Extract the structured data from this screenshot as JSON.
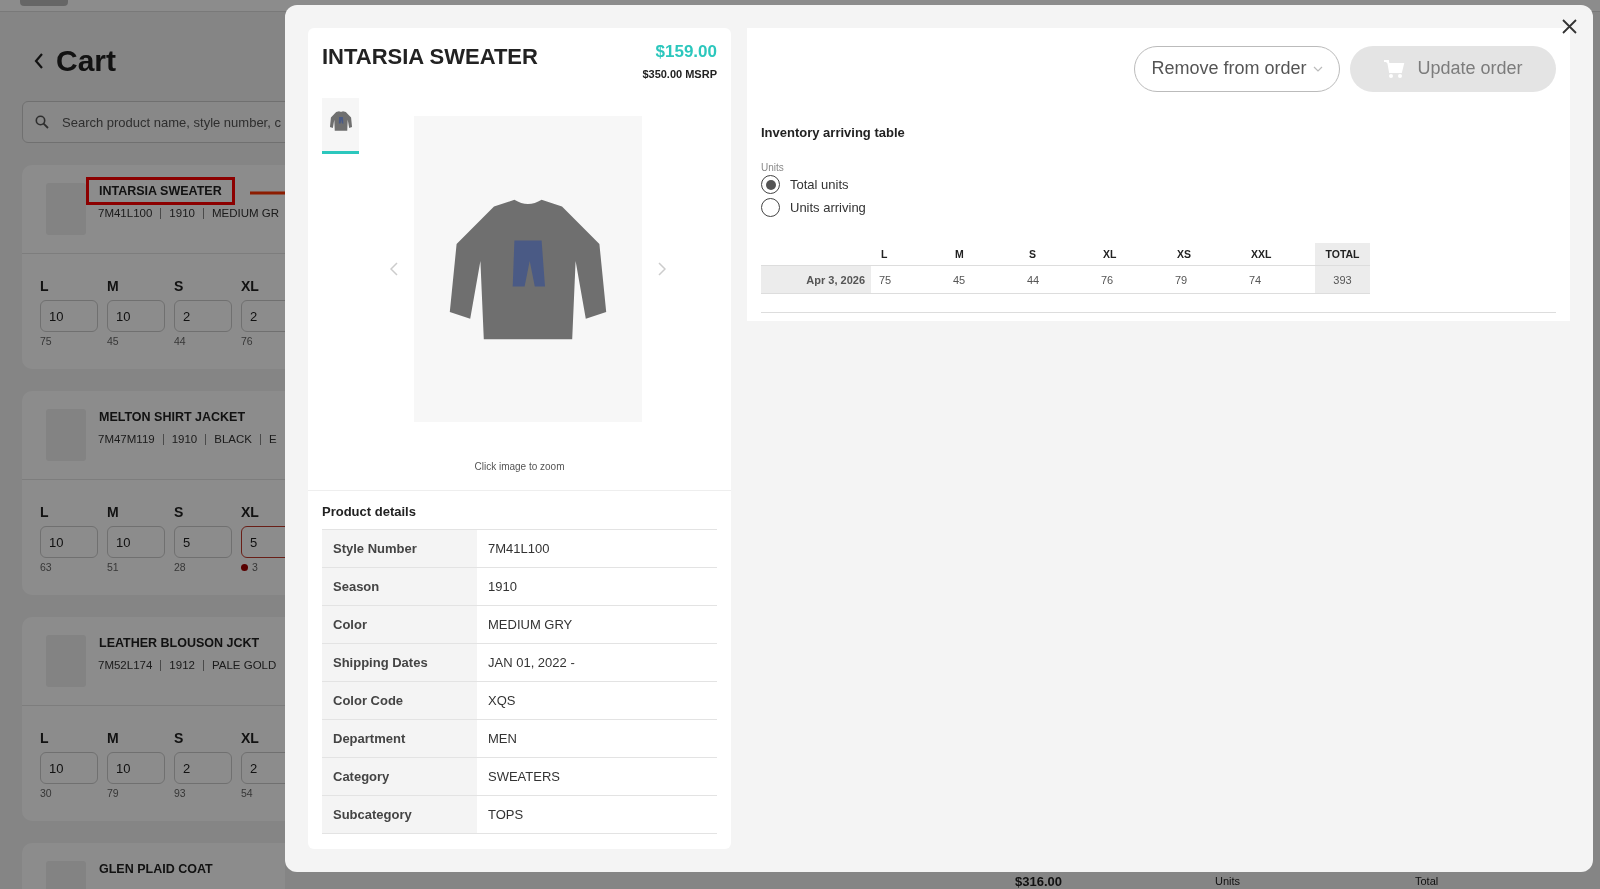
{
  "cart": {
    "title": "Cart",
    "search": {
      "placeholder": "Search product name, style number, c"
    },
    "items": [
      {
        "name": "INTARSIA SWEATER",
        "highlighted": true,
        "meta": [
          "7M41L100",
          "1910",
          "MEDIUM GR"
        ],
        "sizes": [
          {
            "label": "L",
            "value": "10",
            "available": "75",
            "error": false
          },
          {
            "label": "M",
            "value": "10",
            "available": "45",
            "error": false
          },
          {
            "label": "S",
            "value": "2",
            "available": "44",
            "error": false
          },
          {
            "label": "XL",
            "value": "2",
            "available": "76",
            "error": false
          }
        ]
      },
      {
        "name": "MELTON SHIRT JACKET",
        "highlighted": false,
        "meta": [
          "7M47M119",
          "1910",
          "BLACK",
          "E"
        ],
        "sizes": [
          {
            "label": "L",
            "value": "10",
            "available": "63",
            "error": false
          },
          {
            "label": "M",
            "value": "10",
            "available": "51",
            "error": false
          },
          {
            "label": "S",
            "value": "5",
            "available": "28",
            "error": false
          },
          {
            "label": "XL",
            "value": "5",
            "available": "3",
            "error": true
          }
        ]
      },
      {
        "name": "LEATHER BLOUSON JCKT",
        "highlighted": false,
        "meta": [
          "7M52L174",
          "1912",
          "PALE GOLD"
        ],
        "sizes": [
          {
            "label": "L",
            "value": "10",
            "available": "30",
            "error": false
          },
          {
            "label": "M",
            "value": "10",
            "available": "79",
            "error": false
          },
          {
            "label": "S",
            "value": "2",
            "available": "93",
            "error": false
          },
          {
            "label": "XL",
            "value": "2",
            "available": "54",
            "error": false
          }
        ]
      },
      {
        "name": "GLEN PLAID COAT",
        "highlighted": false
      }
    ]
  },
  "summary": {
    "total_price": "$316.00",
    "column_2": "Units",
    "column_3": "Total"
  },
  "modal": {
    "product": {
      "name": "INTARSIA SWEATER",
      "price": "$159.00",
      "msrp": "$350.00 MSRP",
      "thumbnails": [
        {
          "selected": true
        }
      ],
      "zoom_hint": "Click image to zoom"
    },
    "details": {
      "title": "Product details",
      "rows": [
        {
          "label": "Style Number",
          "value": "7M41L100"
        },
        {
          "label": "Season",
          "value": "1910"
        },
        {
          "label": "Color",
          "value": "MEDIUM GRY"
        },
        {
          "label": "Shipping Dates",
          "value": "JAN 01, 2022 -"
        },
        {
          "label": "Color Code",
          "value": "XQS"
        },
        {
          "label": "Department",
          "value": "MEN"
        },
        {
          "label": "Category",
          "value": "SWEATERS"
        },
        {
          "label": "Subcategory",
          "value": "TOPS"
        }
      ]
    },
    "actions": {
      "remove": {
        "label": "Remove from order"
      },
      "update": {
        "label": "Update order",
        "disabled": true
      }
    },
    "inventory": {
      "title": "Inventory arriving table",
      "units_label": "Units",
      "options": [
        {
          "label": "Total units",
          "selected": true
        },
        {
          "label": "Units arriving",
          "selected": false
        }
      ],
      "columns": [
        "L",
        "M",
        "S",
        "XL",
        "XS",
        "XXL"
      ],
      "total_label": "TOTAL",
      "rows": [
        {
          "date": "Apr 3, 2026",
          "values": [
            "75",
            "45",
            "44",
            "76",
            "79",
            "74"
          ],
          "total": "393"
        }
      ]
    }
  }
}
